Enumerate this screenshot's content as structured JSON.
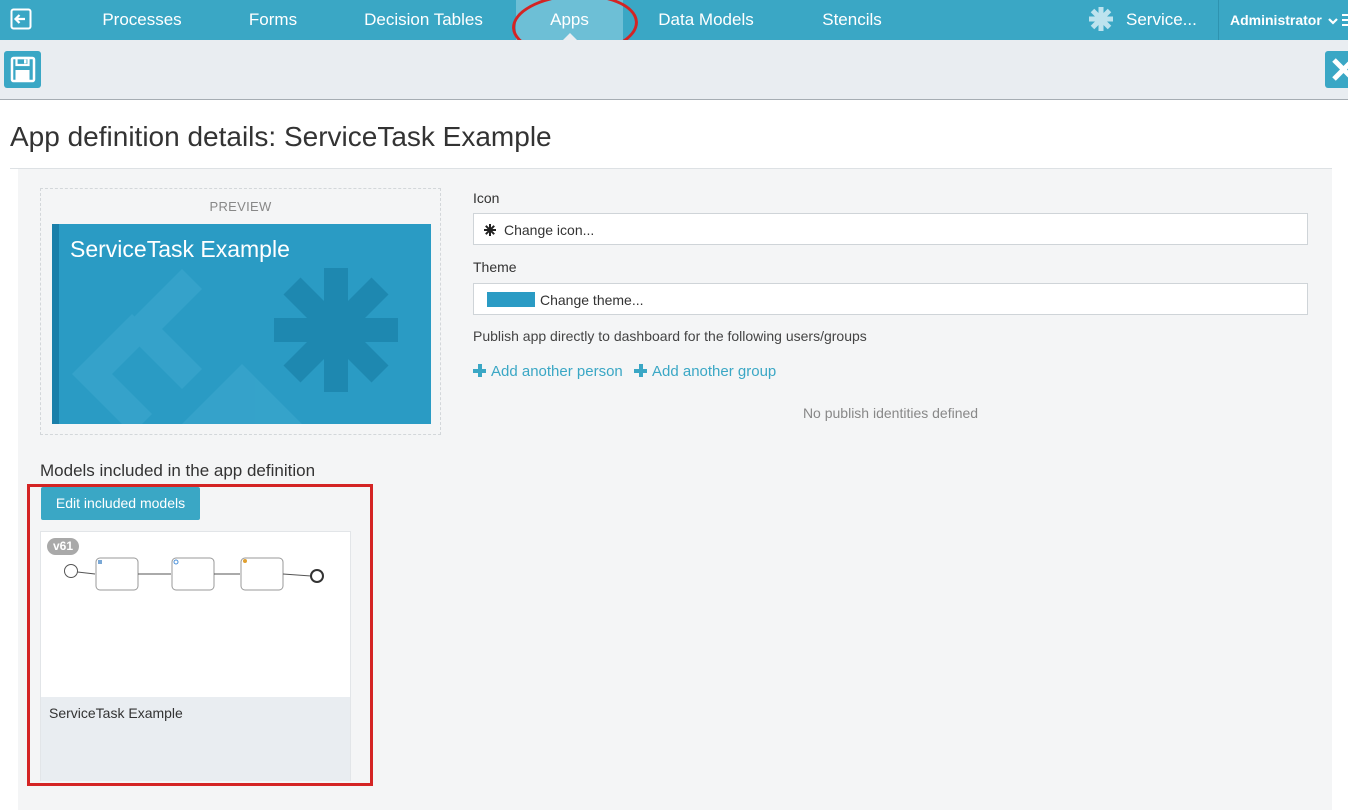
{
  "nav": {
    "items": [
      {
        "label": "Processes"
      },
      {
        "label": "Forms"
      },
      {
        "label": "Decision Tables"
      },
      {
        "label": "Apps"
      },
      {
        "label": "Data Models"
      },
      {
        "label": "Stencils"
      }
    ],
    "active": "Apps",
    "app_name": "Service...",
    "user": "Administrator"
  },
  "page": {
    "title": "App definition details: ServiceTask Example"
  },
  "preview": {
    "label": "PREVIEW",
    "app_title": "ServiceTask Example"
  },
  "form": {
    "icon_label": "Icon",
    "icon_button": "Change icon...",
    "theme_label": "Theme",
    "theme_button": "Change theme...",
    "publish_text": "Publish app directly to dashboard for the following users/groups",
    "add_person": "Add another person",
    "add_group": "Add another group",
    "no_identities": "No publish identities defined"
  },
  "models": {
    "heading": "Models included in the app definition",
    "edit_button": "Edit included models",
    "items": [
      {
        "version": "v61",
        "name": "ServiceTask Example"
      }
    ]
  },
  "colors": {
    "primary": "#3aa7c5",
    "theme": "#2a9bc4",
    "annotation": "#d42424"
  }
}
